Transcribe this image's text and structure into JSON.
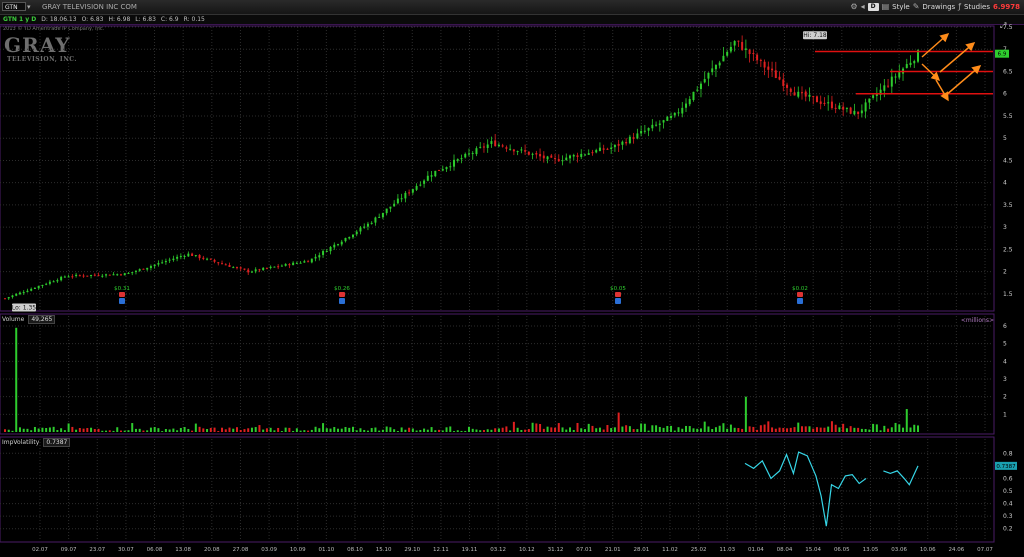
{
  "toolbar": {
    "symbol": "GTN",
    "company_link": "GRAY TELEVISION INC COM",
    "aggregation": "D",
    "style_label": "Style",
    "drawings_label": "Drawings",
    "studies_label": "Studies",
    "last_price": "6.9978"
  },
  "status": {
    "symbol_tag": "GTN 1 y D",
    "date": "D: 18.06.13",
    "open": "O: 6.83",
    "high": "H: 6.98",
    "low": "L: 6.83",
    "close": "C: 6.9",
    "range": "R: 0.15"
  },
  "watermark": {
    "copyright": "2013 © TD Ameritrade IP Company, Inc.",
    "logo_text": "GRAY",
    "logo_sub": "TELEVISION, INC."
  },
  "panels": {
    "volume_name": "Volume",
    "volume_value": "49,265",
    "volume_unit": "<millions>",
    "iv_name": "ImpVolatility",
    "iv_value": "0.7387"
  },
  "colors": {
    "up": "#2ecc2e",
    "down": "#e02020",
    "iv_line": "#36d6e7",
    "level_line": "#e01010",
    "arrow": "#ff8c1a",
    "grid": "#2d2d2d",
    "panel_border": "#4a1b66"
  },
  "chart_data": [
    {
      "type": "candlestick",
      "title": "GTN 1 y D",
      "ylim": [
        1.25,
        7.5
      ],
      "yticks": [
        "7.5",
        "7",
        "6.5",
        "6",
        "5.5",
        "5",
        "4.5",
        "4",
        "3.5",
        "3",
        "2.5",
        "2",
        "1.5"
      ],
      "last_price_label": "6.9",
      "annotations": {
        "high_label": "Hi: 7.18",
        "low_label": "Lo: 1.35",
        "dividends": [
          "$0.31",
          "$0.26",
          "$0.05",
          "$0.02"
        ]
      },
      "key_points": [
        {
          "date": "02.07",
          "close": 1.4
        },
        {
          "date": "30.07",
          "close": 1.9
        },
        {
          "date": "10.09",
          "close": 1.95
        },
        {
          "date": "01.10",
          "close": 2.4
        },
        {
          "date": "12.11",
          "close": 2.0
        },
        {
          "date": "12.12",
          "close": 2.25
        },
        {
          "date": "07.01",
          "close": 3.1
        },
        {
          "date": "21.01",
          "close": 4.2
        },
        {
          "date": "11.02",
          "close": 4.9
        },
        {
          "date": "25.02",
          "close": 4.5
        },
        {
          "date": "01.04",
          "close": 4.8
        },
        {
          "date": "15.04",
          "close": 5.5
        },
        {
          "date": "06.05",
          "close": 7.18
        },
        {
          "date": "20.05",
          "close": 6.0
        },
        {
          "date": "03.06",
          "close": 5.55
        },
        {
          "date": "18.06",
          "close": 6.9
        }
      ],
      "levels": [
        6.95,
        6.5,
        6.0
      ]
    },
    {
      "type": "bar",
      "title": "Volume",
      "unit": "<millions>",
      "ylim": [
        0,
        6
      ],
      "yticks": [
        "6",
        "5",
        "4",
        "3",
        "2",
        "1"
      ],
      "peaks": [
        {
          "date": "02.07",
          "value": 5.9
        },
        {
          "date": "11.02",
          "value": 1.1
        },
        {
          "date": "15.04",
          "value": 2.0
        },
        {
          "date": "18.06",
          "value": 1.3
        }
      ]
    },
    {
      "type": "line",
      "title": "ImpVolatility",
      "ylim": [
        0.15,
        0.85
      ],
      "yticks": [
        "0.8",
        "0.6",
        "0.5",
        "0.4",
        "0.3",
        "0.2"
      ],
      "last_value": "0.7387",
      "points": [
        {
          "x": 0.0,
          "y": 0.72
        },
        {
          "x": 0.05,
          "y": 0.68
        },
        {
          "x": 0.1,
          "y": 0.74
        },
        {
          "x": 0.15,
          "y": 0.6
        },
        {
          "x": 0.2,
          "y": 0.66
        },
        {
          "x": 0.24,
          "y": 0.79
        },
        {
          "x": 0.28,
          "y": 0.64
        },
        {
          "x": 0.31,
          "y": 0.81
        },
        {
          "x": 0.36,
          "y": 0.78
        },
        {
          "x": 0.41,
          "y": 0.62
        },
        {
          "x": 0.44,
          "y": 0.46
        },
        {
          "x": 0.47,
          "y": 0.22
        },
        {
          "x": 0.5,
          "y": 0.55
        },
        {
          "x": 0.54,
          "y": 0.52
        },
        {
          "x": 0.58,
          "y": 0.62
        },
        {
          "x": 0.62,
          "y": 0.63
        },
        {
          "x": 0.66,
          "y": 0.56
        },
        {
          "x": 0.7,
          "y": 0.6
        },
        {
          "x": 0.8,
          "y": 0.66
        },
        {
          "x": 0.84,
          "y": 0.64
        },
        {
          "x": 0.88,
          "y": 0.66
        },
        {
          "x": 0.92,
          "y": 0.6
        },
        {
          "x": 0.95,
          "y": 0.55
        },
        {
          "x": 1.0,
          "y": 0.7
        }
      ]
    }
  ],
  "x_axis": {
    "ticks": [
      "02.07",
      "09.07",
      "23.07",
      "30.07",
      "06.08",
      "13.08",
      "20.08",
      "27.08",
      "03.09",
      "10.09",
      "01.10",
      "08.10",
      "15.10",
      "29.10",
      "12.11",
      "19.11",
      "03.12",
      "10.12",
      "31.12",
      "07.01",
      "21.01",
      "28.01",
      "11.02",
      "25.02",
      "11.03",
      "01.04",
      "08.04",
      "15.04",
      "06.05",
      "13.05",
      "03.06",
      "10.06",
      "24.06",
      "07.07"
    ]
  }
}
